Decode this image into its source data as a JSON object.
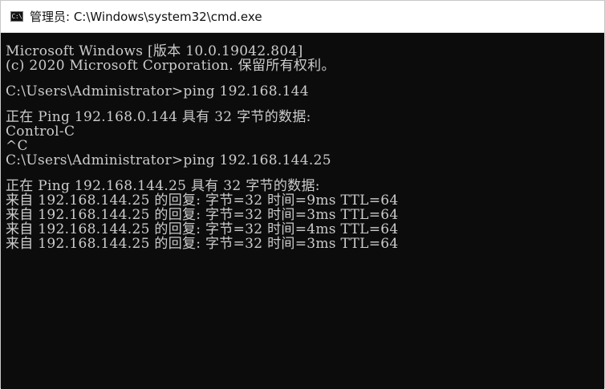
{
  "window": {
    "icon": "cmd-icon",
    "icon_text": "C:\\",
    "title": "管理员: C:\\Windows\\system32\\cmd.exe"
  },
  "console": {
    "lines": [
      "Microsoft Windows [版本 10.0.19042.804]",
      "(c) 2020 Microsoft Corporation. 保留所有权利。",
      "",
      "C:\\Users\\Administrator>ping 192.168.144",
      "",
      "正在 Ping 192.168.0.144 具有 32 字节的数据:",
      "Control-C",
      "^C",
      "C:\\Users\\Administrator>ping 192.168.144.25",
      "",
      "正在 Ping 192.168.144.25 具有 32 字节的数据:",
      "来自 192.168.144.25 的回复: 字节=32 时间=9ms TTL=64",
      "来自 192.168.144.25 的回复: 字节=32 时间=3ms TTL=64",
      "来自 192.168.144.25 的回复: 字节=32 时间=4ms TTL=64",
      "来自 192.168.144.25 的回复: 字节=32 时间=3ms TTL=64"
    ]
  },
  "colors": {
    "console_bg": "#0c0c0c",
    "console_text": "#cccccc",
    "titlebar_bg": "#ffffff"
  }
}
